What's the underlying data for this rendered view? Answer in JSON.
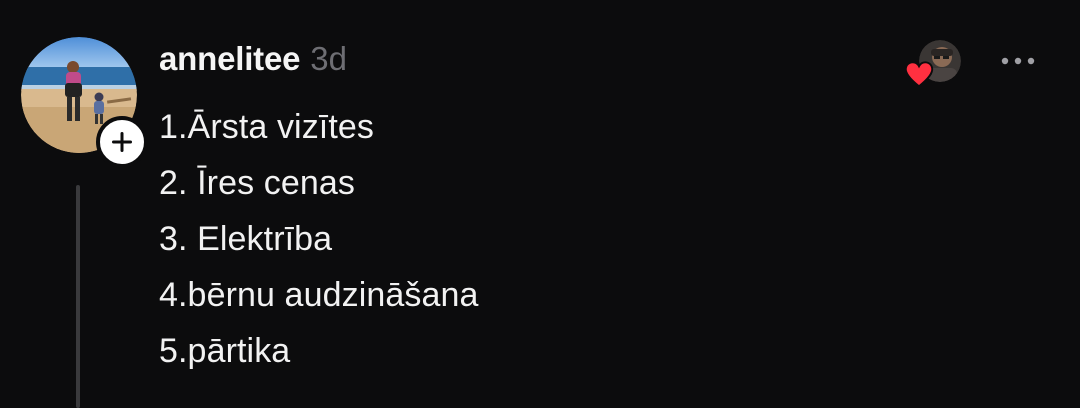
{
  "post": {
    "author": {
      "username": "annelitee",
      "avatar_icon": "beach-photo-avatar",
      "follow_icon": "plus-icon"
    },
    "timestamp": "3d",
    "content_lines": [
      "1.Ārsta vizītes",
      "2. Īres cenas",
      "3. Elektrība",
      "4.bērnu audzināšana",
      "5.pārtika"
    ],
    "liked_by": {
      "avatar_icon": "user-avatar",
      "heart_icon": "heart-icon",
      "heart_color": "#ff3040"
    },
    "more_icon": "more-horizontal-icon"
  },
  "colors": {
    "background": "#0c0c0d",
    "text_primary": "#f2f2f2",
    "text_secondary": "#6e6e73",
    "thread_line": "#3a3a3c"
  }
}
